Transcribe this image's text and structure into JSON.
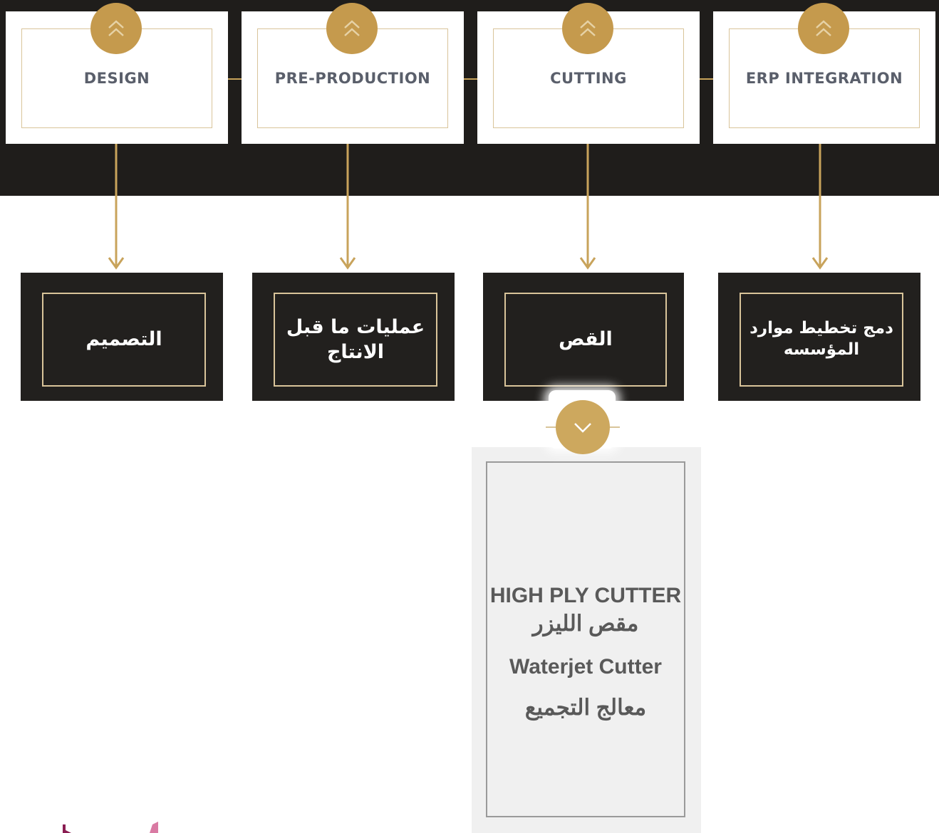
{
  "colors": {
    "gold": "#c59a4d",
    "band": "#1f1d1b",
    "card_dark": "#22201e",
    "card_border": "#d9c49a",
    "stage_text": "#5a5f6b",
    "panel_bg": "#f0f0f0",
    "panel_text": "#595959"
  },
  "stages": [
    {
      "label": "DESIGN",
      "icon": "double-chevron-up-icon"
    },
    {
      "label": "PRE-PRODUCTION",
      "icon": "double-chevron-up-icon"
    },
    {
      "label": "CUTTING",
      "icon": "double-chevron-up-icon"
    },
    {
      "label": "ERP INTEGRATION",
      "icon": "double-chevron-up-icon"
    }
  ],
  "arabic_labels": [
    "التصميم",
    "عمليات ما قبل الانتاج",
    "القص",
    "دمج تخطيط موارد المؤسسه"
  ],
  "detail": {
    "icon": "chevron-down-icon",
    "items": [
      "HIGH PLY CUTTER",
      "مقص الليزر",
      "Waterjet Cutter",
      "معالج التجميع"
    ]
  }
}
